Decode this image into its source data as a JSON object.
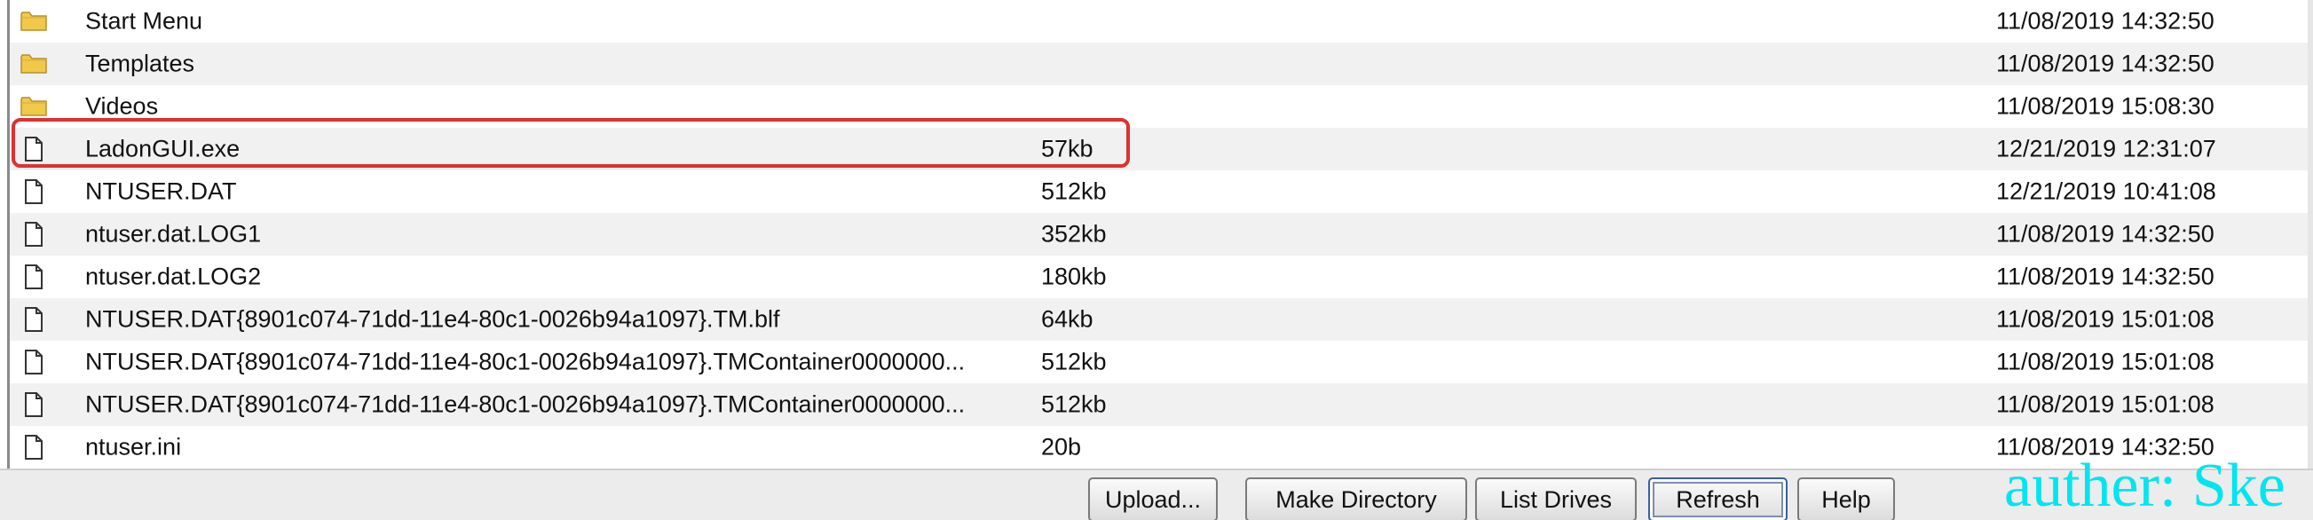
{
  "files": [
    {
      "name": "Start Menu",
      "size": "",
      "date": "11/08/2019 14:32:50",
      "type": "folder",
      "icon": "folder-icon"
    },
    {
      "name": "Templates",
      "size": "",
      "date": "11/08/2019 14:32:50",
      "type": "folder",
      "icon": "folder-icon"
    },
    {
      "name": "Videos",
      "size": "",
      "date": "11/08/2019 15:08:30",
      "type": "folder",
      "icon": "folder-icon"
    },
    {
      "name": "LadonGUI.exe",
      "size": "57kb",
      "date": "12/21/2019 12:31:07",
      "type": "file",
      "icon": "file-icon"
    },
    {
      "name": "NTUSER.DAT",
      "size": "512kb",
      "date": "12/21/2019 10:41:08",
      "type": "file",
      "icon": "file-icon"
    },
    {
      "name": "ntuser.dat.LOG1",
      "size": "352kb",
      "date": "11/08/2019 14:32:50",
      "type": "file",
      "icon": "file-icon"
    },
    {
      "name": "ntuser.dat.LOG2",
      "size": "180kb",
      "date": "11/08/2019 14:32:50",
      "type": "file",
      "icon": "file-icon"
    },
    {
      "name": "NTUSER.DAT{8901c074-71dd-11e4-80c1-0026b94a1097}.TM.blf",
      "size": "64kb",
      "date": "11/08/2019 15:01:08",
      "type": "file",
      "icon": "file-icon"
    },
    {
      "name": "NTUSER.DAT{8901c074-71dd-11e4-80c1-0026b94a1097}.TMContainer0000000...",
      "size": "512kb",
      "date": "11/08/2019 15:01:08",
      "type": "file",
      "icon": "file-icon"
    },
    {
      "name": "NTUSER.DAT{8901c074-71dd-11e4-80c1-0026b94a1097}.TMContainer0000000...",
      "size": "512kb",
      "date": "11/08/2019 15:01:08",
      "type": "file",
      "icon": "file-icon"
    },
    {
      "name": "ntuser.ini",
      "size": "20b",
      "date": "11/08/2019 14:32:50",
      "type": "file",
      "icon": "file-icon"
    }
  ],
  "buttons": {
    "upload": "Upload...",
    "make_directory": "Make Directory",
    "list_drives": "List Drives",
    "refresh": "Refresh",
    "help": "Help"
  },
  "watermark": "auther: Ske",
  "colors": {
    "highlight": "#e03030",
    "watermark": "#00e5ee",
    "row_alt": "#f1f1f1",
    "folder": "#f0c94a"
  }
}
